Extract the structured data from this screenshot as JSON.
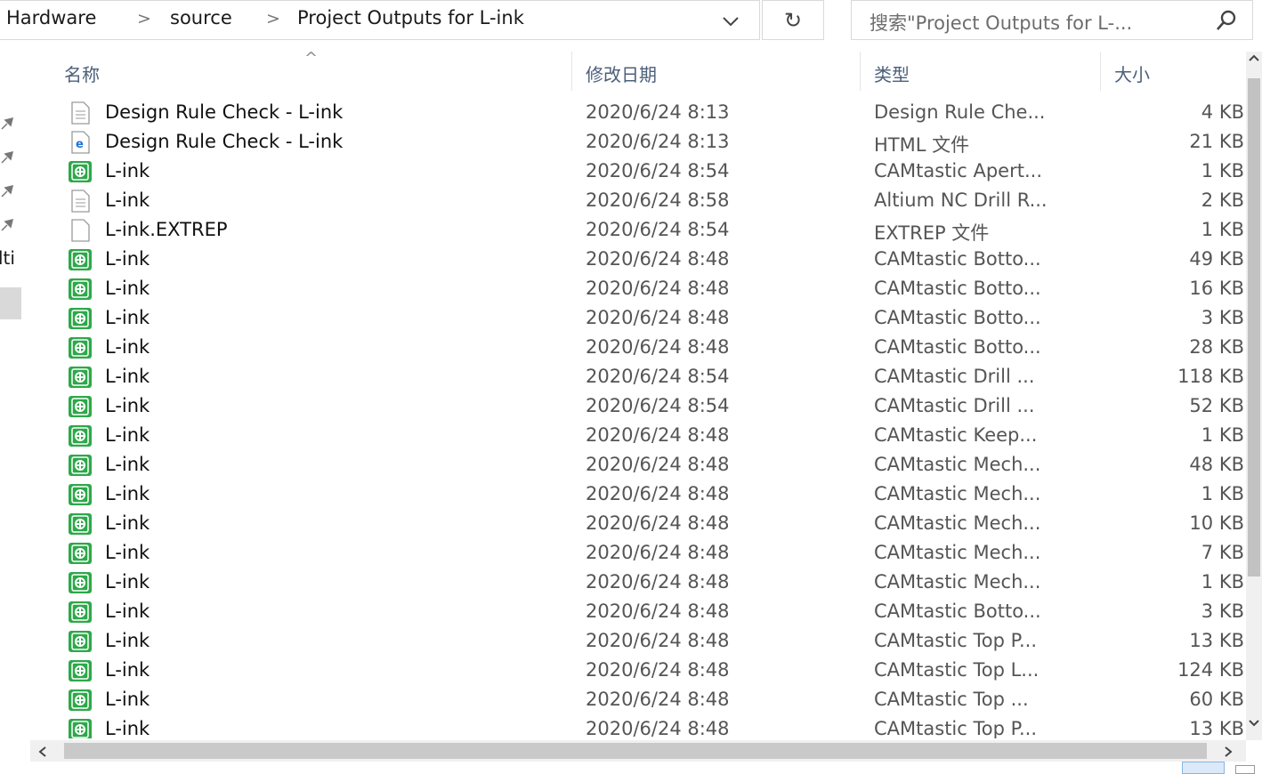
{
  "address_bar": {
    "crumbs": [
      "Hardware",
      "source",
      "Project Outputs for L-ink"
    ],
    "separator": ">",
    "dropdown_glyph": "⌄",
    "refresh_glyph": "↻"
  },
  "search": {
    "placeholder": "搜索\"Project Outputs for L-..."
  },
  "left_pane": {
    "visible_text": "lti"
  },
  "columns": {
    "name": "名称",
    "date": "修改日期",
    "type": "类型",
    "size": "大小",
    "sort_glyph": "^"
  },
  "files": [
    {
      "name": "Design Rule Check - L-ink",
      "date": "2020/6/24 8:13",
      "type": "Design Rule Che...",
      "size": "4 KB",
      "icon": "text-document-icon"
    },
    {
      "name": "Design Rule Check - L-ink",
      "date": "2020/6/24 8:13",
      "type": "HTML 文件",
      "size": "21 KB",
      "icon": "html-file-icon"
    },
    {
      "name": "L-ink",
      "date": "2020/6/24 8:54",
      "type": "CAMtastic Apert...",
      "size": "1 KB",
      "icon": "camtastic-file-icon"
    },
    {
      "name": "L-ink",
      "date": "2020/6/24 8:58",
      "type": "Altium NC Drill R...",
      "size": "2 KB",
      "icon": "text-document-icon"
    },
    {
      "name": "L-ink.EXTREP",
      "date": "2020/6/24 8:54",
      "type": "EXTREP 文件",
      "size": "1 KB",
      "icon": "blank-file-icon"
    },
    {
      "name": "L-ink",
      "date": "2020/6/24 8:48",
      "type": "CAMtastic Botto...",
      "size": "49 KB",
      "icon": "camtastic-file-icon"
    },
    {
      "name": "L-ink",
      "date": "2020/6/24 8:48",
      "type": "CAMtastic Botto...",
      "size": "16 KB",
      "icon": "camtastic-file-icon"
    },
    {
      "name": "L-ink",
      "date": "2020/6/24 8:48",
      "type": "CAMtastic Botto...",
      "size": "3 KB",
      "icon": "camtastic-file-icon"
    },
    {
      "name": "L-ink",
      "date": "2020/6/24 8:48",
      "type": "CAMtastic Botto...",
      "size": "28 KB",
      "icon": "camtastic-file-icon"
    },
    {
      "name": "L-ink",
      "date": "2020/6/24 8:54",
      "type": "CAMtastic Drill ...",
      "size": "118 KB",
      "icon": "camtastic-file-icon"
    },
    {
      "name": "L-ink",
      "date": "2020/6/24 8:54",
      "type": "CAMtastic Drill ...",
      "size": "52 KB",
      "icon": "camtastic-file-icon"
    },
    {
      "name": "L-ink",
      "date": "2020/6/24 8:48",
      "type": "CAMtastic Keep...",
      "size": "1 KB",
      "icon": "camtastic-file-icon"
    },
    {
      "name": "L-ink",
      "date": "2020/6/24 8:48",
      "type": "CAMtastic Mech...",
      "size": "48 KB",
      "icon": "camtastic-file-icon"
    },
    {
      "name": "L-ink",
      "date": "2020/6/24 8:48",
      "type": "CAMtastic Mech...",
      "size": "1 KB",
      "icon": "camtastic-file-icon"
    },
    {
      "name": "L-ink",
      "date": "2020/6/24 8:48",
      "type": "CAMtastic Mech...",
      "size": "10 KB",
      "icon": "camtastic-file-icon"
    },
    {
      "name": "L-ink",
      "date": "2020/6/24 8:48",
      "type": "CAMtastic Mech...",
      "size": "7 KB",
      "icon": "camtastic-file-icon"
    },
    {
      "name": "L-ink",
      "date": "2020/6/24 8:48",
      "type": "CAMtastic Mech...",
      "size": "1 KB",
      "icon": "camtastic-file-icon"
    },
    {
      "name": "L-ink",
      "date": "2020/6/24 8:48",
      "type": "CAMtastic Botto...",
      "size": "3 KB",
      "icon": "camtastic-file-icon"
    },
    {
      "name": "L-ink",
      "date": "2020/6/24 8:48",
      "type": "CAMtastic Top P...",
      "size": "13 KB",
      "icon": "camtastic-file-icon"
    },
    {
      "name": "L-ink",
      "date": "2020/6/24 8:48",
      "type": "CAMtastic Top L...",
      "size": "124 KB",
      "icon": "camtastic-file-icon"
    },
    {
      "name": "L-ink",
      "date": "2020/6/24 8:48",
      "type": "CAMtastic Top ...",
      "size": "60 KB",
      "icon": "camtastic-file-icon"
    },
    {
      "name": "L-ink",
      "date": "2020/6/24 8:48",
      "type": "CAMtastic Top P...",
      "size": "13 KB",
      "icon": "camtastic-file-icon"
    }
  ],
  "colors": {
    "camtastic_icon": "#2ea84a",
    "header_text": "#4c607a",
    "scroll_thumb": "#c2c2c2"
  }
}
